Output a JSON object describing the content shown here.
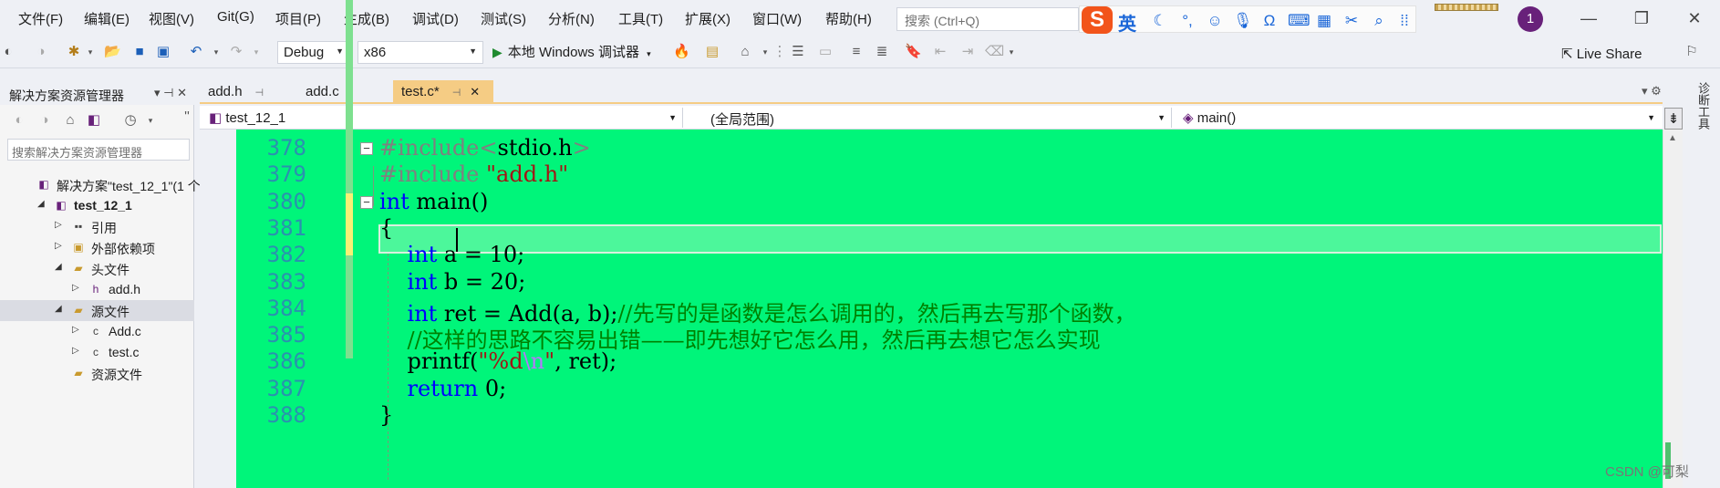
{
  "menu": [
    "文件(F)",
    "编辑(E)",
    "视图(V)",
    "Git(G)",
    "项目(P)",
    "生成(B)",
    "调试(D)",
    "测试(S)",
    "分析(N)",
    "工具(T)",
    "扩展(X)",
    "窗口(W)",
    "帮助(H)"
  ],
  "search": {
    "placeholder": "搜索 (Ctrl+Q)"
  },
  "ime": {
    "logo": "S",
    "lang": "英"
  },
  "notification_count": "1",
  "toolbar": {
    "configuration": "Debug",
    "platform": "x86",
    "run_label": "本地 Windows 调试器",
    "liveshare_label": "Live Share"
  },
  "solution_explorer": {
    "title": "解决方案资源管理器",
    "search_placeholder": "搜索解决方案资源管理器",
    "tree": [
      {
        "label": "解决方案\"test_12_1\"(1 个",
        "depth": 0,
        "expander": "",
        "icon": "solution-icon"
      },
      {
        "label": "test_12_1",
        "depth": 1,
        "expander": "◢",
        "icon": "project-icon",
        "bold": true
      },
      {
        "label": "引用",
        "depth": 2,
        "expander": "▷",
        "icon": "references-icon"
      },
      {
        "label": "外部依赖项",
        "depth": 2,
        "expander": "▷",
        "icon": "external-deps-icon"
      },
      {
        "label": "头文件",
        "depth": 2,
        "expander": "◢",
        "icon": "folder-icon"
      },
      {
        "label": "add.h",
        "depth": 3,
        "expander": "▷",
        "icon": "header-file-icon"
      },
      {
        "label": "源文件",
        "depth": 2,
        "expander": "◢",
        "icon": "folder-icon",
        "selected": true
      },
      {
        "label": "Add.c",
        "depth": 3,
        "expander": "▷",
        "icon": "c-file-icon"
      },
      {
        "label": "test.c",
        "depth": 3,
        "expander": "▷",
        "icon": "c-file-icon"
      },
      {
        "label": "资源文件",
        "depth": 2,
        "expander": "",
        "icon": "folder-icon"
      }
    ]
  },
  "tabs": [
    {
      "label": "add.h",
      "active": false,
      "pinned": true
    },
    {
      "label": "add.c",
      "active": false,
      "pinned": false
    },
    {
      "label": "test.c*",
      "active": true,
      "pinned": true
    }
  ],
  "navbar": {
    "project": "test_12_1",
    "scope": "(全局范围)",
    "member": "main()"
  },
  "right_rail_label": "诊断工具",
  "code_lines": [
    {
      "num": "378",
      "tokens": [
        {
          "t": "#include<",
          "c": "pp"
        },
        {
          "t": "stdio.h",
          "c": ""
        },
        {
          "t": ">",
          "c": "pp"
        }
      ],
      "fold": true
    },
    {
      "num": "379",
      "tokens": [
        {
          "t": "#include ",
          "c": "pp"
        },
        {
          "t": "\"add.h\"",
          "c": "str"
        }
      ]
    },
    {
      "num": "380",
      "tokens": [
        {
          "t": "int",
          "c": "kw"
        },
        {
          "t": " main()",
          "c": ""
        }
      ],
      "fold": true
    },
    {
      "num": "381",
      "tokens": [
        {
          "t": "{",
          "c": ""
        }
      ]
    },
    {
      "num": "382",
      "tokens": [
        {
          "t": "    ",
          "c": ""
        },
        {
          "t": "int",
          "c": "kw"
        },
        {
          "t": " a = 10;",
          "c": ""
        }
      ]
    },
    {
      "num": "383",
      "tokens": [
        {
          "t": "    ",
          "c": ""
        },
        {
          "t": "int",
          "c": "kw"
        },
        {
          "t": " b = 20;",
          "c": ""
        }
      ]
    },
    {
      "num": "384",
      "tokens": [
        {
          "t": "    ",
          "c": ""
        },
        {
          "t": "int",
          "c": "kw"
        },
        {
          "t": " ret = Add(a, b);",
          "c": ""
        },
        {
          "t": "//先写的是函数是怎么调用的，然后再去写那个函数，",
          "c": "cm"
        }
      ]
    },
    {
      "num": "385",
      "tokens": [
        {
          "t": "    ",
          "c": ""
        },
        {
          "t": "//这样的思路不容易出错——即先想好它怎么用，然后再去想它怎么实现",
          "c": "cm"
        }
      ]
    },
    {
      "num": "386",
      "tokens": [
        {
          "t": "    printf(",
          "c": ""
        },
        {
          "t": "\"%d",
          "c": "str"
        },
        {
          "t": "\\n",
          "c": "esc"
        },
        {
          "t": "\"",
          "c": "str"
        },
        {
          "t": ", ret);",
          "c": ""
        }
      ]
    },
    {
      "num": "387",
      "tokens": [
        {
          "t": "    ",
          "c": ""
        },
        {
          "t": "return",
          "c": "kw"
        },
        {
          "t": " 0;",
          "c": ""
        }
      ]
    },
    {
      "num": "388",
      "tokens": [
        {
          "t": "}",
          "c": ""
        }
      ]
    }
  ],
  "watermark": "CSDN @可梨",
  "colors": {
    "editor_background": "#00f57a",
    "current_line": "#4cf79b",
    "active_tab": "#f5cc84",
    "keyword": "#0000ff",
    "comment": "#008000",
    "string": "#a31515",
    "line_number": "#2b91af"
  }
}
